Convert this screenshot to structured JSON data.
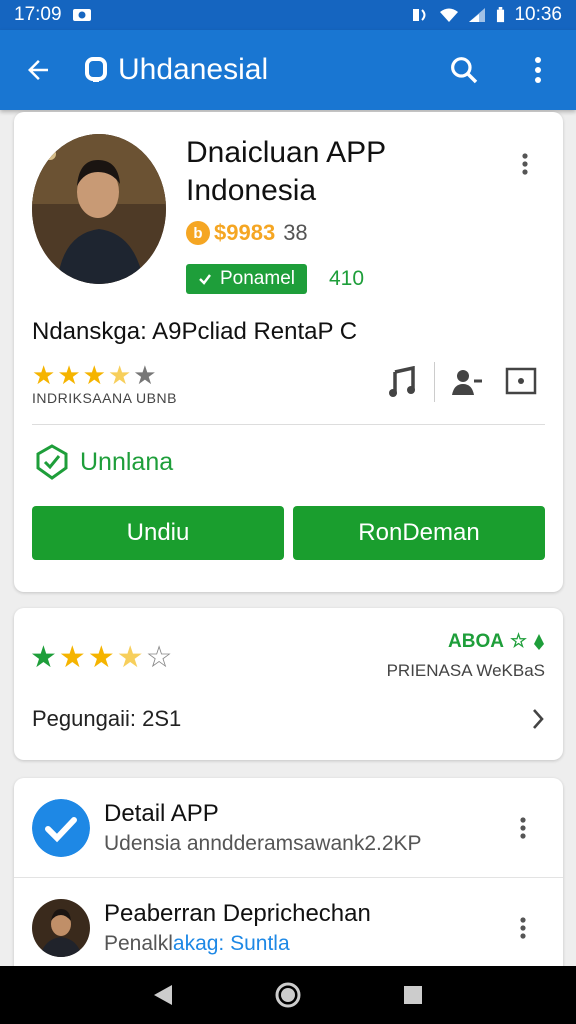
{
  "status_bar": {
    "time_left": "17:09",
    "time_right": "10:36"
  },
  "app_bar": {
    "title": "Uhdanesial"
  },
  "app_card": {
    "name_line1": "Dnaicluan APP",
    "name_line2": "Indonesia",
    "price": "$9983",
    "price_suffix": "38",
    "badge_label": "Ponamel",
    "badge_count": "410",
    "description": "Ndanskga: A9Pcliad RentaP C",
    "rating_caption": "INDRIKSAANA UBNB",
    "rating": 3.5,
    "install_status": "Unnlana",
    "primary_button": "Undiu",
    "secondary_button": "RonDeman"
  },
  "rating_card": {
    "tag": "ABOA",
    "subtitle": "PRIENASA WeKBaS",
    "reviews_label": "Pegungaii: 2S1",
    "rating": 3.5
  },
  "detail_list": [
    {
      "title": "Detail APP",
      "subtitle": "Udensia anndderamsawank2.2KP"
    },
    {
      "title": "Peaberran Deprichechan",
      "subtitle_prefix": "Penalkl",
      "subtitle_link": "akag: Suntla"
    }
  ],
  "colors": {
    "primary_blue": "#1976d2",
    "status_blue": "#1565c0",
    "accent_green": "#1a9e2e",
    "star_yellow": "#f5b400",
    "price_orange": "#f5a623"
  },
  "icons": {
    "back": "arrow-left",
    "search": "magnifier",
    "more": "vertical-dots",
    "music": "music-note",
    "person": "person-add",
    "tv": "screen",
    "check": "checkmark",
    "chevron": "chevron-right"
  }
}
